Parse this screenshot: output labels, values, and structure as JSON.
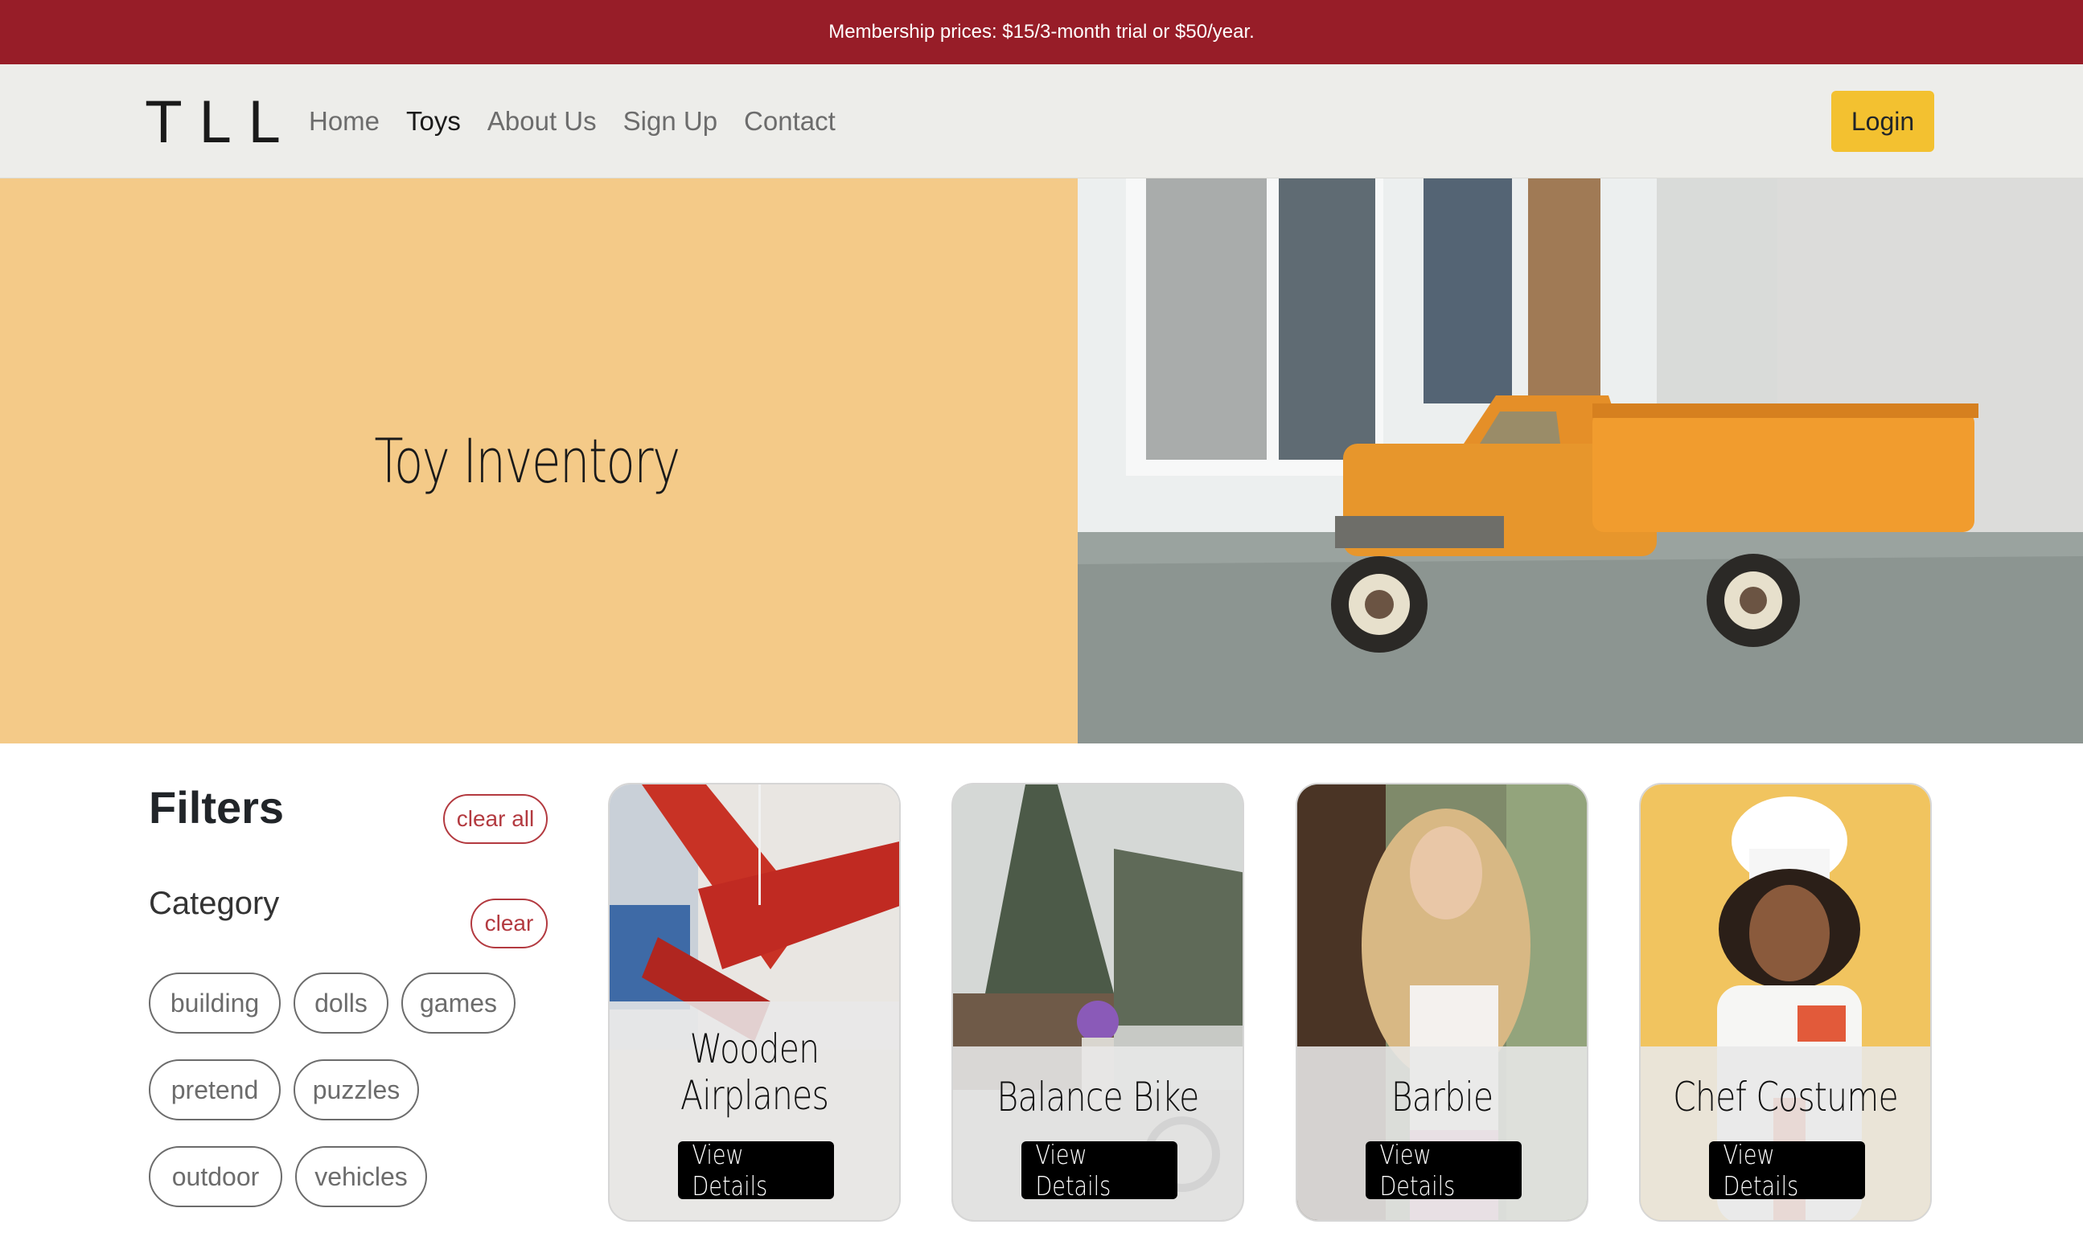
{
  "announcement": "Membership prices: $15/3-month trial or $50/year.",
  "nav": {
    "logo": "TLL",
    "links": [
      "Home",
      "Toys",
      "About Us",
      "Sign Up",
      "Contact"
    ],
    "active": "Toys",
    "login": "Login"
  },
  "hero": {
    "title": "Toy Inventory"
  },
  "filters": {
    "title": "Filters",
    "clear_all": "clear all",
    "category": {
      "title": "Category",
      "clear": "clear",
      "tags": [
        "building",
        "dolls",
        "games",
        "pretend",
        "puzzles",
        "outdoor",
        "vehicles"
      ]
    }
  },
  "cards": [
    {
      "name_line1": "Wooden",
      "name_line2": "Airplanes",
      "button": "View Details"
    },
    {
      "name": "Balance Bike",
      "button": "View Details"
    },
    {
      "name": "Barbie",
      "button": "View Details"
    },
    {
      "name": "Chef Costume",
      "button": "View Details"
    }
  ],
  "colors": {
    "announcement_bg": "#971d28",
    "nav_bg": "#ededea",
    "login_bg": "#f3c130",
    "hero_bg": "#f4ca88",
    "filter_accent": "#b33a40"
  }
}
